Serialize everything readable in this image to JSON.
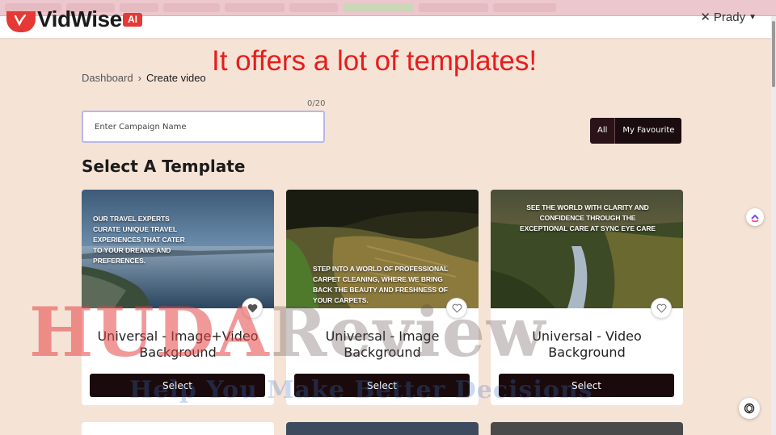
{
  "header": {
    "logo_text": "VidWise",
    "logo_badge": "AI",
    "user_name": "Prady"
  },
  "annotation": "It offers a lot of templates!",
  "breadcrumb": {
    "root": "Dashboard",
    "separator": "›",
    "current": "Create video"
  },
  "campaign": {
    "placeholder": "Enter Campaign Name",
    "char_count": "0/20"
  },
  "filters": {
    "all_label": "All",
    "favourite_label": "My Favourite"
  },
  "section_title": "Select A Template",
  "templates": [
    {
      "caption": "Our travel experts curate unique travel experiences that cater to your dreams and preferences.",
      "name_line1": "Universal - Image+Video",
      "name_line2": "Background",
      "select_label": "Select",
      "favourited": true
    },
    {
      "caption": "Step into a world of professional carpet cleaning, where we bring back the beauty and freshness of your carpets.",
      "name_line1": "Universal - Image",
      "name_line2": "Background",
      "select_label": "Select",
      "favourited": false
    },
    {
      "caption": "See the world with clarity and confidence through the exceptional care at Sync Eye Care",
      "name_line1": "Universal - Video",
      "name_line2": "Background",
      "select_label": "Select",
      "favourited": false
    }
  ],
  "watermark": {
    "title_part1": "HUDA",
    "title_part2": "Review",
    "tagline": "Help You Make Better Decisions"
  },
  "colors": {
    "page_bg": "#f5e3d6",
    "brand_red": "#e53935",
    "dark_button": "#1a0a0c",
    "annotation_red": "#e81c1c"
  }
}
